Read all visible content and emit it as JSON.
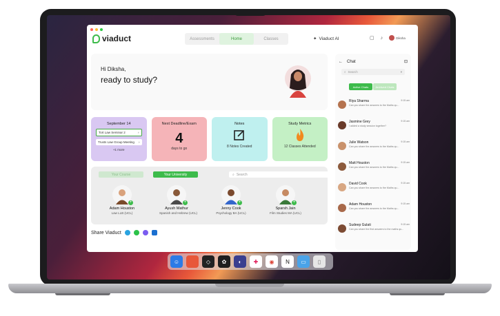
{
  "app": {
    "name": "viaduct"
  },
  "nav": {
    "tabs": [
      "Assessments",
      "Home",
      "Classes"
    ],
    "active": "Home"
  },
  "ai_label": "Viaduct AI",
  "user": {
    "name": "Diksha"
  },
  "greeting": {
    "hi": "Hi Diksha,",
    "sub": "ready to study?"
  },
  "calendar": {
    "date": "September 14",
    "events": [
      "Tort Law Seminar 2",
      "Trusts Law Group Meeting"
    ],
    "more": "+1 more"
  },
  "deadline": {
    "title": "Next Deadline/Exam",
    "number": "4",
    "caption": "days to go"
  },
  "notes": {
    "title": "Notes",
    "caption": "8 Notes Created"
  },
  "metrics": {
    "title": "Study Metrics",
    "caption": "12 Classes Attended"
  },
  "course": {
    "tab1": "Your Course",
    "tab2": "Your University",
    "search": "Search",
    "people": [
      {
        "name": "Adam Houston",
        "desc": "Law LLB (UCL)"
      },
      {
        "name": "Ayush Mathur",
        "desc": "Spanish and Hebrew (UCL)"
      },
      {
        "name": "Jenny Cook",
        "desc": "Psychology BA (UCL)"
      },
      {
        "name": "Sparsh Jain",
        "desc": "Film Studies MA (UCL)"
      }
    ]
  },
  "share": {
    "label": "Share Viaduct"
  },
  "chat": {
    "title": "Chat",
    "search": "Search",
    "toggle_active": "Active Chats",
    "toggle_other": "Archived Chats",
    "messages": [
      {
        "name": "Riya Sharma",
        "time": "9:15 am",
        "text": "Can you share the answers to the Maths qu..."
      },
      {
        "name": "Jasmine Grey",
        "time": "9:15 am",
        "text": "I added a study session together?"
      },
      {
        "name": "Julie Watson",
        "time": "9:15 am",
        "text": "Can you share the answers to the Maths qu..."
      },
      {
        "name": "Matt Houston",
        "time": "9:15 am",
        "text": "Can you share the answers to the Maths qu..."
      },
      {
        "name": "David Cook",
        "time": "9:15 am",
        "text": "Can you share the answers to the Maths qu..."
      },
      {
        "name": "Adam Houston",
        "time": "9:15 am",
        "text": "Can you share the answers to the Maths qu..."
      },
      {
        "name": "Sudeep Gulati",
        "time": "9:15 am",
        "text": "Can you share the first answers to the maths qu..."
      }
    ]
  },
  "colors": {
    "accent": "#3dbb4b"
  }
}
